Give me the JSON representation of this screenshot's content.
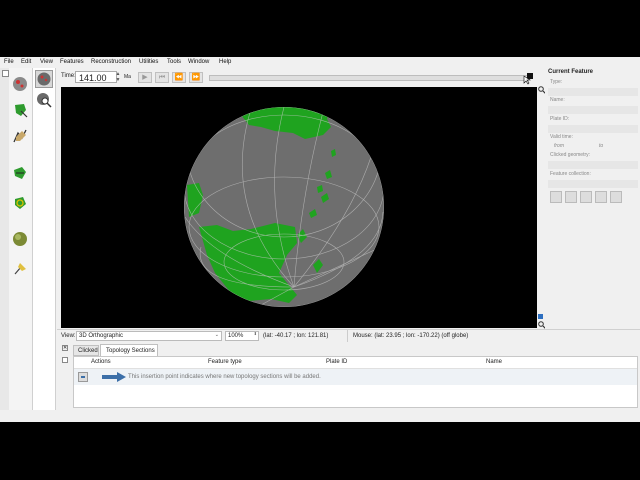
{
  "menu": [
    "File",
    "Edit",
    "View",
    "Features",
    "Reconstruction",
    "Utilities",
    "Tools",
    "Window",
    "Help"
  ],
  "time": {
    "label": "Time:",
    "value": "141.00",
    "unit": "Ma"
  },
  "current_feature": {
    "title": "Current Feature",
    "type_label": "Type:",
    "name_label": "Name:",
    "plate_id_label": "Plate ID:",
    "valid_time_label": "Valid time:",
    "from_label": "from",
    "to_label": "to",
    "clicked_geometry_label": "Clicked geometry:",
    "feature_collection_label": "Feature collection:"
  },
  "status": {
    "view_label": "View:",
    "projection": "3D Orthographic",
    "zoom": "100%",
    "camera": "(lat: -40.17 ; lon: 121.81)",
    "mouse": "Mouse: (lat: 23.95 ; lon: -170.22) (off globe)"
  },
  "tabs": [
    "Clicked",
    "Topology Sections"
  ],
  "table": {
    "columns": [
      "Actions",
      "Feature type",
      "Plate ID",
      "Name"
    ],
    "insertion_text": "This insertion point indicates where new topology sections will be added."
  },
  "colors": {
    "land": "#1fa31f",
    "ocean": "#6e6e6e",
    "background": "#000000",
    "accent_arrow": "#3c6fa8"
  }
}
